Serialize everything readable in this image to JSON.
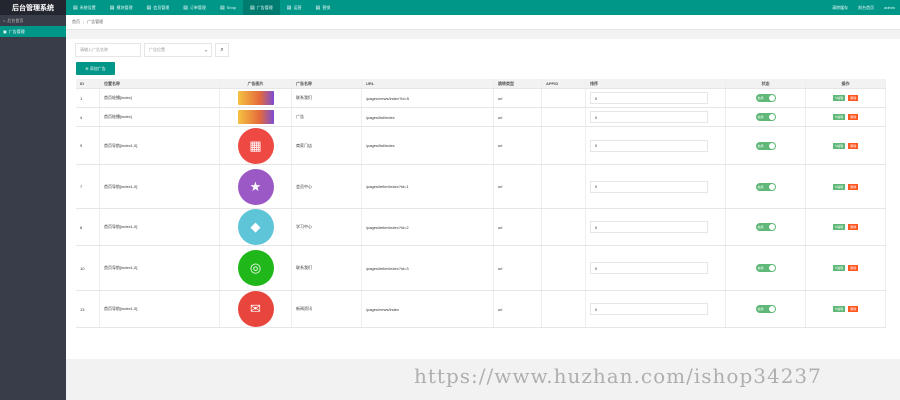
{
  "app": {
    "title": "后台管理系统"
  },
  "nav": [
    {
      "icon": "▤",
      "label": "系统设置"
    },
    {
      "icon": "▤",
      "label": "模块管理"
    },
    {
      "icon": "▤",
      "label": "会员管理"
    },
    {
      "icon": "▤",
      "label": "订单管理"
    },
    {
      "icon": "▤",
      "label": "Shop"
    },
    {
      "icon": "▤",
      "label": "广告管理"
    },
    {
      "icon": "▤",
      "label": "运营"
    },
    {
      "icon": "▤",
      "label": "营销"
    }
  ],
  "top_right": {
    "clear": "清除缓存",
    "frontend": "前台首页",
    "user": "admin"
  },
  "sidebar": [
    {
      "icon": "⌂",
      "label": "后台首页"
    },
    {
      "icon": "▣",
      "label": "广告管理"
    }
  ],
  "breadcrumb": {
    "home": "首页",
    "current": "广告管理"
  },
  "filter": {
    "keyword_placeholder": "请输入广告名称",
    "position_placeholder": "广告位置",
    "search_icon": "⌕"
  },
  "add_button": "添加广告",
  "headers": {
    "id": "ID",
    "name": "位置名称",
    "image": "广告图片",
    "title": "广告名称",
    "url": "URL",
    "jump": "跳转类型",
    "appid": "APPID",
    "sort": "排序",
    "status": "状态",
    "op": "操作"
  },
  "rows": [
    {
      "id": "1",
      "name": "首页轮播[index]",
      "image": "banner",
      "title": "联系我们",
      "url": "/pages/news/index?id=5",
      "jump": "url",
      "sort": "0",
      "status": "启用",
      "edit": "编辑",
      "del": "删除"
    },
    {
      "id": "4",
      "name": "首页轮播[index]",
      "image": "banner",
      "title": "广告",
      "url": "/pages/list/index",
      "jump": "url",
      "sort": "0",
      "status": "启用",
      "edit": "编辑",
      "del": "删除"
    },
    {
      "id": "9",
      "name": "首页导航[index1,0]",
      "image": "shop",
      "title": "商家门店",
      "url": "/pages/list/index",
      "jump": "url",
      "sort": "0",
      "status": "启用",
      "edit": "编辑",
      "del": "删除"
    },
    {
      "id": "7",
      "name": "首页导航[index1,0]",
      "image": "star",
      "title": "会员中心",
      "url": "/pages/letter/index?id=1",
      "jump": "url",
      "sort": "0",
      "status": "启用",
      "edit": "编辑",
      "del": "删除"
    },
    {
      "id": "8",
      "name": "首页导航[index1,0]",
      "image": "cap",
      "title": "学习中心",
      "url": "/pages/letter/index?id=2",
      "jump": "url",
      "sort": "0",
      "status": "启用",
      "edit": "编辑",
      "del": "删除"
    },
    {
      "id": "10",
      "name": "首页导航[index1,0]",
      "image": "chat",
      "title": "联系我们",
      "url": "/pages/letter/index?id=3",
      "jump": "url",
      "sort": "0",
      "status": "启用",
      "edit": "编辑",
      "del": "删除"
    },
    {
      "id": "13",
      "name": "首页导航[index1,0]",
      "image": "news",
      "title": "新闻资讯",
      "url": "/pages/news/index",
      "jump": "url",
      "sort": "0",
      "status": "启用",
      "edit": "编辑",
      "del": "删除"
    }
  ],
  "colors": {
    "primary": "#009688",
    "sidebar": "#393d49",
    "logo_bg": "#23262e",
    "toggle_on": "#5fb878",
    "danger": "#ff5722"
  },
  "image_styles": {
    "shop": {
      "bg": "#ee4a43",
      "glyph": "▦"
    },
    "star": {
      "bg": "#9b59c6",
      "glyph": "★"
    },
    "cap": {
      "bg": "#5ec4d7",
      "glyph": "◆"
    },
    "chat": {
      "bg": "#20b71b",
      "glyph": "◎"
    },
    "news": {
      "bg": "#e8453c",
      "glyph": "✉"
    }
  },
  "watermark": "https://www.huzhan.com/ishop34237"
}
